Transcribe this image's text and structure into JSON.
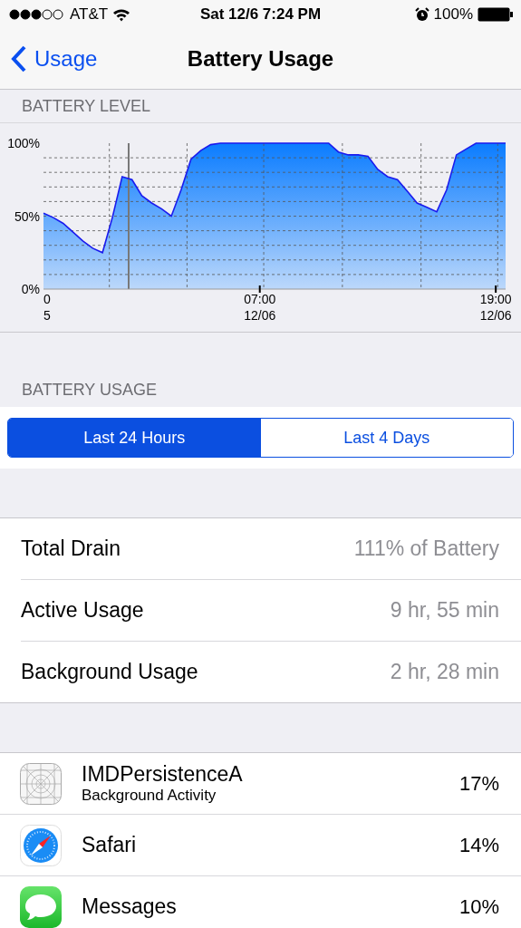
{
  "status_bar": {
    "carrier": "AT&T",
    "time": "Sat 12/6 7:24 PM",
    "battery": "100%"
  },
  "nav": {
    "back": "Usage",
    "title": "Battery Usage"
  },
  "battery_level": {
    "header": "BATTERY LEVEL",
    "chart_data": {
      "type": "area",
      "yticks": [
        {
          "value": 0,
          "label": "0%"
        },
        {
          "value": 50,
          "label": "50%"
        },
        {
          "value": 100,
          "label": "100%"
        }
      ],
      "categories": [
        "0\n5",
        null,
        null,
        null,
        null,
        null,
        null,
        null,
        null,
        null,
        null,
        null,
        null,
        null,
        null,
        null,
        null,
        null,
        null,
        null,
        null,
        null,
        "07:00\n12/06",
        null,
        null,
        null,
        null,
        null,
        null,
        null,
        null,
        null,
        null,
        null,
        null,
        null,
        null,
        null,
        null,
        null,
        null,
        null,
        null,
        null,
        null,
        null,
        "19:00\n12/06",
        null
      ],
      "series": [
        {
          "color": "#0a7cff",
          "values": [
            52,
            49,
            45,
            39,
            33,
            28,
            25,
            49,
            77,
            75,
            64,
            59,
            55,
            50,
            68,
            89,
            95,
            99,
            100,
            100,
            100,
            100,
            100,
            100,
            100,
            100,
            100,
            100,
            100,
            100,
            94,
            92,
            92,
            91,
            82,
            77,
            75,
            67,
            59,
            56,
            53,
            68,
            92,
            96,
            100,
            100,
            100,
            100
          ]
        }
      ],
      "ylim": [
        0,
        100
      ]
    }
  },
  "usage_header": "BATTERY USAGE",
  "segments": [
    {
      "label": "Last 24 Hours",
      "selected": true
    },
    {
      "label": "Last 4 Days",
      "selected": false
    }
  ],
  "summary": [
    {
      "label": "Total Drain",
      "value": "111% of Battery"
    },
    {
      "label": "Active Usage",
      "value": "9 hr, 55 min"
    },
    {
      "label": "Background Usage",
      "value": "2 hr, 28 min"
    }
  ],
  "apps": [
    {
      "kind": "placeholder",
      "name": "IMDPersistenceA",
      "detail": "Background Activity",
      "percent": "17%"
    },
    {
      "kind": "safari",
      "name": "Safari",
      "percent": "14%"
    },
    {
      "kind": "messages",
      "name": "Messages",
      "percent": "10%"
    }
  ]
}
